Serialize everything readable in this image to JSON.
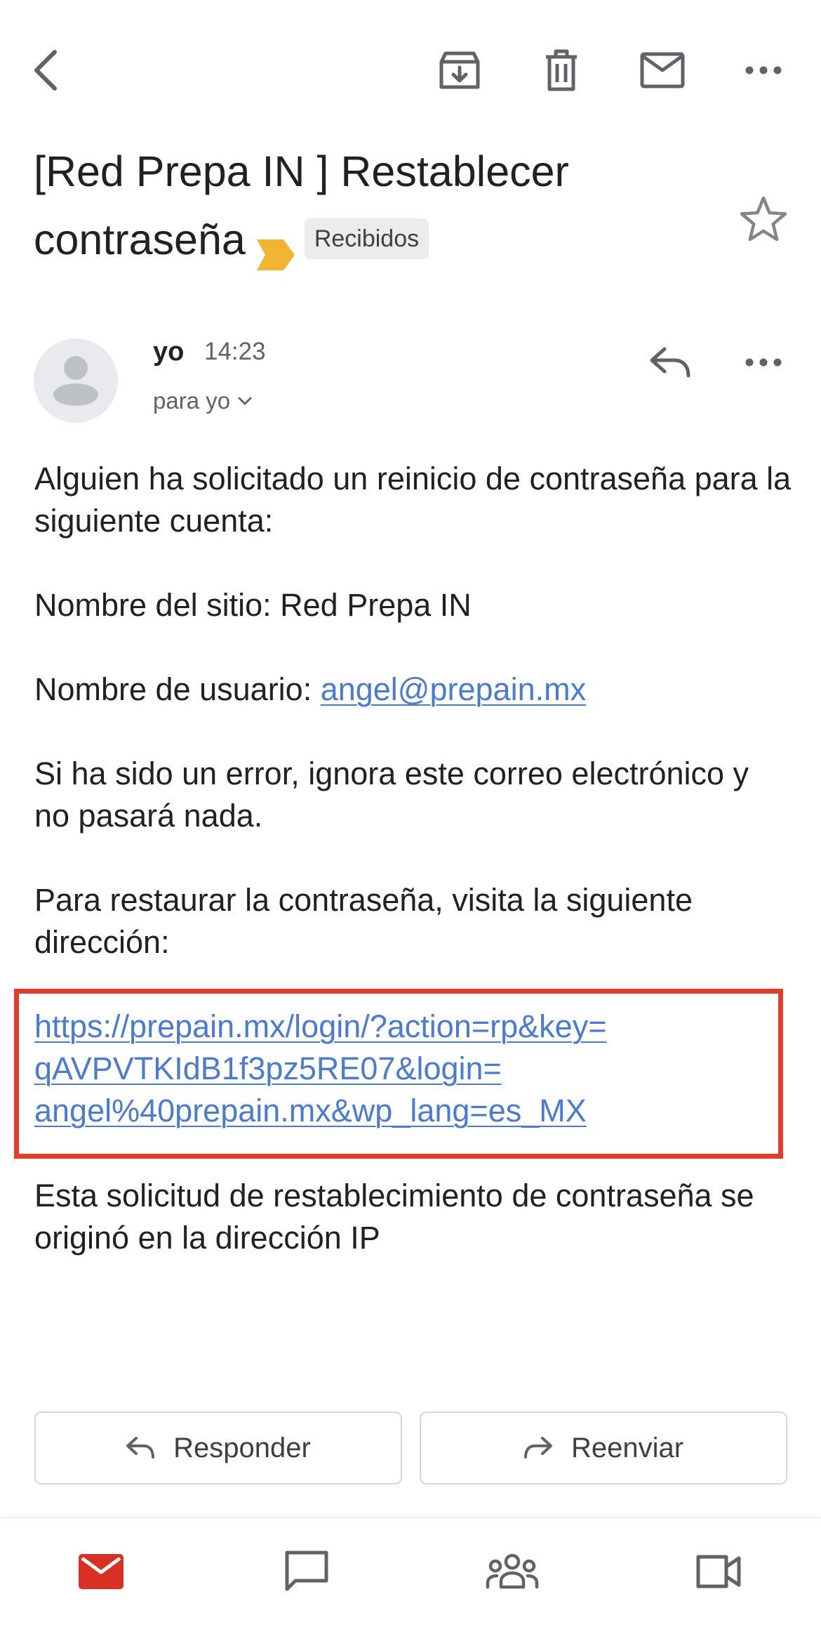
{
  "toolbar": {
    "back_icon": "back-arrow-icon",
    "archive_icon": "archive-icon",
    "delete_icon": "trash-icon",
    "mark_unread_icon": "mail-icon",
    "more_icon": "more-horizontal-icon"
  },
  "subject": {
    "title": "[Red Prepa IN ] Restablecer contraseña",
    "importance_marker_color": "#f2b531",
    "label": "Recibidos"
  },
  "message": {
    "sender": "yo",
    "time": "14:23",
    "recipient": "para yo",
    "paragraphs": {
      "intro": "Alguien ha solicitado un reinicio de contraseña para la siguiente cuenta:",
      "site_name": "Nombre del sitio: Red Prepa IN",
      "username_prefix": "Nombre de usuario: ",
      "username_link": "angel@prepain.mx",
      "error_note": "Si ha sido un error, ignora este correo electrónico y no pasará nada.",
      "restore_instructions": "Para restaurar la contraseña, visita la siguiente dirección:",
      "reset_link_line1": "https://prepain.mx/login/?action=rp&key=",
      "reset_link_line2": "qAVPVTKIdB1f3pz5RE07&login=",
      "reset_link_line3": "angel%40prepain.mx&wp_lang=es_MX",
      "ip_note": "Esta solicitud de restablecimiento de contraseña se originó en la dirección IP"
    }
  },
  "actions": {
    "reply": "Responder",
    "forward": "Reenviar"
  },
  "bottom_nav": {
    "items": [
      "mail-icon",
      "chat-icon",
      "spaces-icon",
      "meet-icon"
    ],
    "active_color": "#d93025"
  },
  "colors": {
    "link": "#4a7bd0",
    "highlight_border": "#e23c2a",
    "icon_gray": "#5f6368"
  }
}
